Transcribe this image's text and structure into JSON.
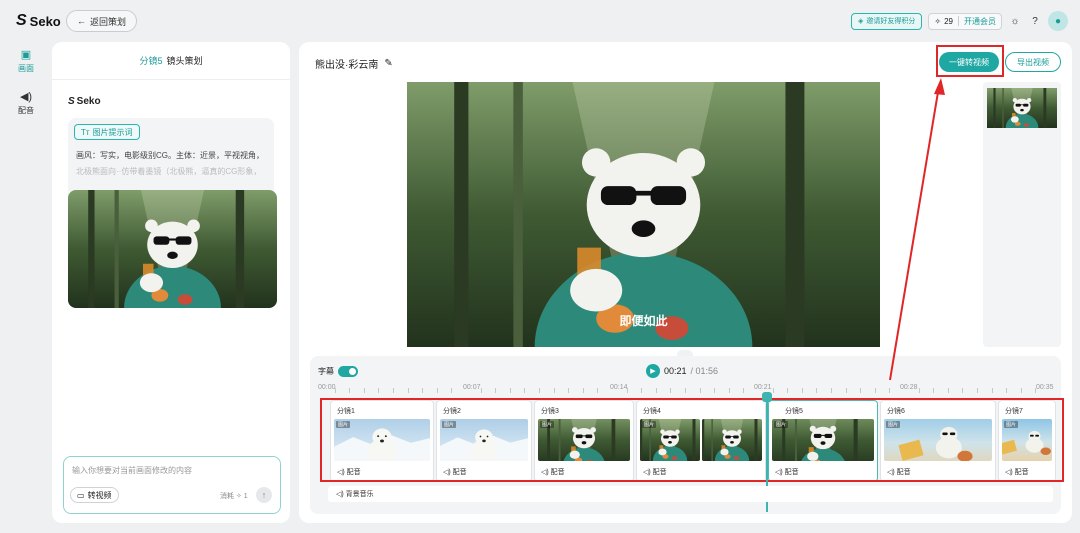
{
  "app": {
    "name": "Seko",
    "back_label": "返回策划"
  },
  "topbar": {
    "invite_label": "邀请好友得积分",
    "credits": "29",
    "vip_label": "开通会员"
  },
  "rail": {
    "items": [
      {
        "label": "画面"
      },
      {
        "label": "配音"
      }
    ]
  },
  "storyboard": {
    "shot_label": "分镜5",
    "title": "镜头策划",
    "brand": "Seko",
    "prompt_tag": "图片提示词",
    "prompt_line1": "画风：写实，电影级别CG。主体：近景，平视视角，",
    "prompt_line2": "北极熊面向··仿带着墨镜（北极熊，逼真的CG形象，",
    "chat_placeholder": "输入你想要对当前画面修改的内容",
    "convert_label": "转视频",
    "cost_label": "消耗",
    "cost_value": "1"
  },
  "main": {
    "project_title": "熊出没·彩云南",
    "convert_button": "一键转视频",
    "export_button": "导出视频",
    "subtitle_text": "即便如此"
  },
  "timeline": {
    "subtitle_toggle_label": "字幕",
    "current_time": "00:21",
    "total_time": "/ 01:56",
    "ticks": [
      "00:00",
      "00:07",
      "00:14",
      "00:21",
      "00:28",
      "00:35"
    ],
    "image_tag": "图片",
    "audio_label": "配音",
    "bgm_label": "背景音乐",
    "clips": [
      {
        "name": "分镜1"
      },
      {
        "name": "分镜2"
      },
      {
        "name": "分镜3"
      },
      {
        "name": "分镜4"
      },
      {
        "name": "分镜5"
      },
      {
        "name": "分镜6"
      },
      {
        "name": "分镜7"
      }
    ]
  },
  "colors": {
    "accent": "#1fa8a3",
    "annotation": "#e02626"
  }
}
